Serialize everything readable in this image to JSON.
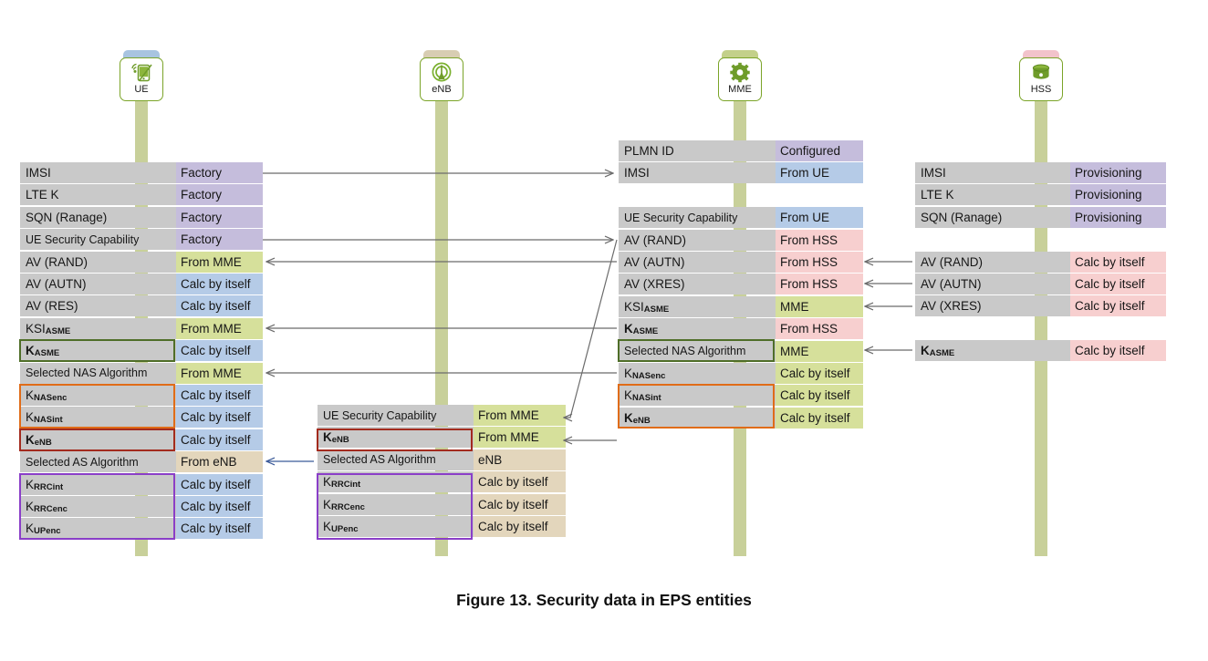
{
  "caption": "Figure 13. Security data in EPS entities",
  "palette": {
    "label_bg": "#c9c9c9",
    "lifeline": "#c8d09a",
    "purple": "#c5bddc",
    "green": "#d6e09b",
    "blue": "#b5cbe7",
    "pink": "#f7cfcf",
    "tan": "#e3d6bc",
    "node_border": "#7ba428",
    "arrow_gray": "#6b6b6b",
    "arrow_blue": "#3b5a99",
    "outline_green": "#4f6e28",
    "outline_orange": "#e06c18",
    "outline_red": "#a32b1e",
    "outline_purple": "#8a3ec8"
  },
  "nodes": [
    {
      "id": "ue",
      "label": "UE",
      "icon": "mobile-device-icon",
      "tab_color": "#a8c4e0"
    },
    {
      "id": "enb",
      "label": "eNB",
      "icon": "antenna-tower-icon",
      "tab_color": "#d8cdb2"
    },
    {
      "id": "mme",
      "label": "MME",
      "icon": "gear-icon",
      "tab_color": "#c3d08a"
    },
    {
      "id": "hss",
      "label": "HSS",
      "icon": "database-icon",
      "tab_color": "#f2c3cb"
    }
  ],
  "columns": [
    {
      "id": "ue",
      "node": "UE",
      "rows": [
        {
          "label": "IMSI",
          "value": "Factory",
          "color": "purple",
          "bold": false
        },
        {
          "label": "LTE K",
          "value": "Factory",
          "color": "purple",
          "bold": false
        },
        {
          "label": "SQN (Ranage)",
          "value": "Factory",
          "color": "purple",
          "bold": false
        },
        {
          "label": "UE Security Capability",
          "value": "Factory",
          "color": "purple",
          "bold": false
        },
        {
          "label": "AV (RAND)",
          "value": "From MME",
          "color": "green",
          "bold": false
        },
        {
          "label": "AV (AUTN)",
          "value": "Calc by itself",
          "color": "blue",
          "bold": false
        },
        {
          "label": "AV (RES)",
          "value": "Calc by itself",
          "color": "blue",
          "bold": false
        },
        {
          "label": "KSI|ASME",
          "value": "From MME",
          "color": "green",
          "bold": false
        },
        {
          "label": "K|ASME",
          "value": "Calc by itself",
          "color": "blue",
          "bold": true
        },
        {
          "label": "Selected NAS Algorithm",
          "value": "From MME",
          "color": "green",
          "bold": false
        },
        {
          "label": "K|NASenc",
          "value": "Calc by itself",
          "color": "blue",
          "bold": false
        },
        {
          "label": "K|NASint",
          "value": "Calc by itself",
          "color": "blue",
          "bold": false
        },
        {
          "label": "K|eNB",
          "value": "Calc by itself",
          "color": "blue",
          "bold": true
        },
        {
          "label": "Selected AS Algorithm",
          "value": "From eNB",
          "color": "tan",
          "bold": false
        },
        {
          "label": "K|RRCint",
          "value": "Calc by itself",
          "color": "blue",
          "bold": false
        },
        {
          "label": "K|RRCenc",
          "value": "Calc by itself",
          "color": "blue",
          "bold": false
        },
        {
          "label": "K|UPenc",
          "value": "Calc by itself",
          "color": "blue",
          "bold": false
        }
      ]
    },
    {
      "id": "enb",
      "node": "eNB",
      "rows": [
        {
          "label": "UE Security Capability",
          "value": "From MME",
          "color": "green",
          "bold": false
        },
        {
          "label": "K|eNB",
          "value": "From MME",
          "color": "green",
          "bold": true
        },
        {
          "label": "Selected AS Algorithm",
          "value": "eNB",
          "color": "tan",
          "bold": false
        },
        {
          "label": "K|RRCint",
          "value": "Calc by itself",
          "color": "tan",
          "bold": false
        },
        {
          "label": "K|RRCenc",
          "value": "Calc by itself",
          "color": "tan",
          "bold": false
        },
        {
          "label": "K|UPenc",
          "value": "Calc by itself",
          "color": "tan",
          "bold": false
        }
      ]
    },
    {
      "id": "mme",
      "node": "MME",
      "rows": [
        {
          "label": "PLMN ID",
          "value": "Configured",
          "color": "purple",
          "bold": false
        },
        {
          "label": "IMSI",
          "value": "From UE",
          "color": "blue",
          "bold": false
        },
        {
          "label": "UE Security Capability",
          "value": "From UE",
          "color": "blue",
          "bold": false
        },
        {
          "label": "AV (RAND)",
          "value": "From HSS",
          "color": "pink",
          "bold": false
        },
        {
          "label": "AV (AUTN)",
          "value": "From HSS",
          "color": "pink",
          "bold": false
        },
        {
          "label": "AV (XRES)",
          "value": "From HSS",
          "color": "pink",
          "bold": false
        },
        {
          "label": "KSI|ASME",
          "value": "MME",
          "color": "green",
          "bold": false
        },
        {
          "label": "K|ASME",
          "value": "From HSS",
          "color": "pink",
          "bold": true
        },
        {
          "label": "Selected NAS Algorithm",
          "value": "MME",
          "color": "green",
          "bold": false
        },
        {
          "label": "K|NASenc",
          "value": "Calc by itself",
          "color": "green",
          "bold": false
        },
        {
          "label": "K|NASint",
          "value": "Calc by itself",
          "color": "green",
          "bold": false
        },
        {
          "label": "K|eNB",
          "value": "Calc by itself",
          "color": "green",
          "bold": true
        }
      ]
    },
    {
      "id": "hss",
      "node": "HSS",
      "rows": [
        {
          "label": "IMSI",
          "value": "Provisioning",
          "color": "purple",
          "bold": false
        },
        {
          "label": "LTE K",
          "value": "Provisioning",
          "color": "purple",
          "bold": false
        },
        {
          "label": "SQN (Ranage)",
          "value": "Provisioning",
          "color": "purple",
          "bold": false
        },
        {
          "label": "AV (RAND)",
          "value": "Calc by itself",
          "color": "pink",
          "bold": false
        },
        {
          "label": "AV (AUTN)",
          "value": "Calc by itself",
          "color": "pink",
          "bold": false
        },
        {
          "label": "AV (XRES)",
          "value": "Calc by itself",
          "color": "pink",
          "bold": false
        },
        {
          "label": "K|ASME",
          "value": "Calc by itself",
          "color": "pink",
          "bold": true
        }
      ]
    }
  ],
  "flows": [
    {
      "from": "UE IMSI",
      "to": "MME IMSI",
      "direction": "right"
    },
    {
      "from": "UE UE Security Capability",
      "to": "MME UE Security Capability",
      "direction": "right"
    },
    {
      "from": "MME AV (RAND)",
      "to": "UE AV (RAND)",
      "direction": "left"
    },
    {
      "from": "MME KSI ASME",
      "to": "UE KSI ASME",
      "direction": "left"
    },
    {
      "from": "MME Selected NAS Algorithm",
      "to": "UE Selected NAS Algorithm",
      "direction": "left"
    },
    {
      "from": "MME UE Security Capability",
      "to": "eNB UE Security Capability",
      "direction": "diagonal"
    },
    {
      "from": "MME K eNB",
      "to": "eNB K eNB",
      "direction": "left"
    },
    {
      "from": "eNB Selected AS Algorithm",
      "to": "UE Selected AS Algorithm",
      "direction": "left"
    },
    {
      "from": "HSS AV (RAND)",
      "to": "MME AV (RAND)",
      "direction": "left"
    },
    {
      "from": "HSS AV (AUTN)",
      "to": "MME AV (AUTN)",
      "direction": "left"
    },
    {
      "from": "HSS AV (XRES)",
      "to": "MME AV (XRES)",
      "direction": "left"
    },
    {
      "from": "HSS K ASME",
      "to": "MME K ASME",
      "direction": "left"
    }
  ]
}
